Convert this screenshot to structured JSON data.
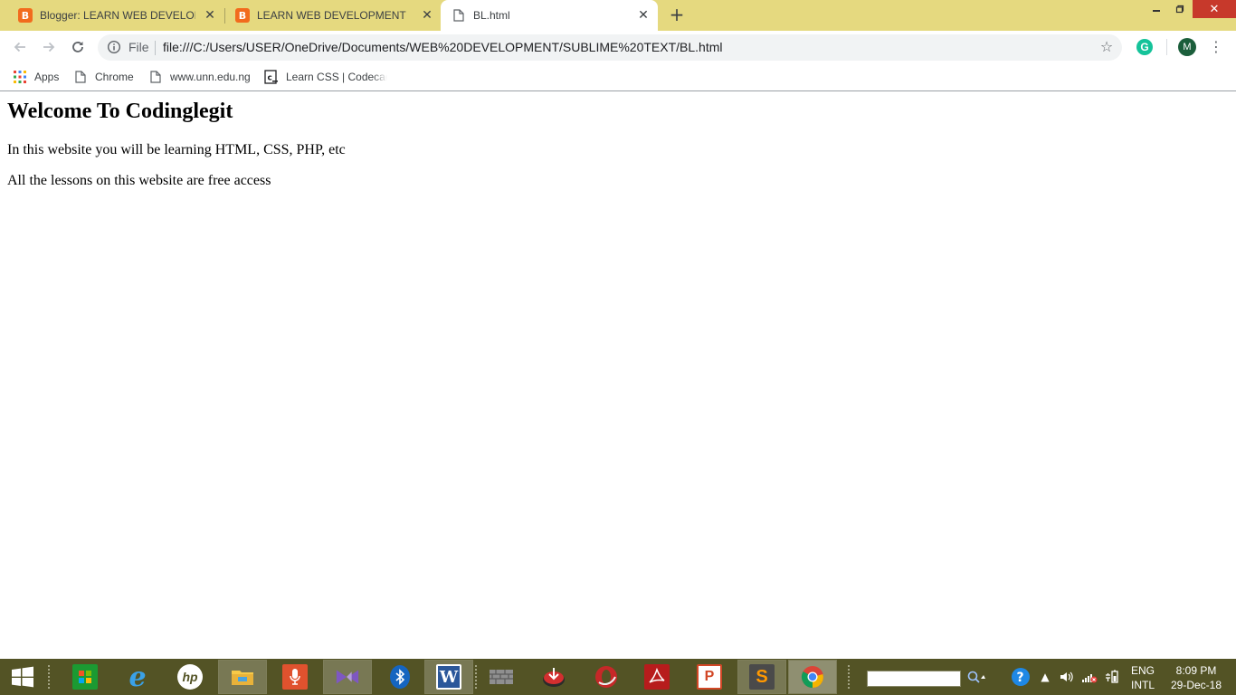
{
  "browser": {
    "tabs": [
      {
        "title": "Blogger: LEARN WEB DEVELOPM",
        "favicon": "blogger-icon",
        "active": false
      },
      {
        "title": "LEARN WEB DEVELOPMENT",
        "favicon": "blogger-icon",
        "active": false
      },
      {
        "title": "BL.html",
        "favicon": "page-icon",
        "active": true
      }
    ],
    "omnibox": {
      "scheme_label": "File",
      "url": "file:///C:/Users/USER/OneDrive/Documents/WEB%20DEVELOPMENT/SUBLIME%20TEXT/BL.html"
    },
    "profile_initial": "M",
    "extension_letter": "G",
    "bookmarks": [
      {
        "label": "Apps",
        "icon": "apps-grid-icon"
      },
      {
        "label": "Chrome",
        "icon": "page-icon"
      },
      {
        "label": "www.unn.edu.ng",
        "icon": "page-icon"
      },
      {
        "label": "Learn CSS | Codecademy",
        "icon": "codecademy-icon"
      }
    ],
    "colors": {
      "tab_strip": "#e5d97f",
      "blogger": "#f26b1d",
      "close_button": "#c7392b"
    }
  },
  "page": {
    "heading": "Welcome To Codinglegit",
    "paragraphs": [
      "In this website you will be learning HTML, CSS, PHP, etc",
      "All the lessons on this website are free access"
    ]
  },
  "taskbar": {
    "apps": [
      "windows-store-icon",
      "internet-explorer-icon",
      "hp-icon",
      "file-explorer-icon",
      "voice-recorder-icon",
      "visual-studio-icon",
      "bluetooth-icon",
      "word-icon",
      "firewall-icon",
      "media-downloader-icon",
      "opera-icon",
      "acrobat-icon",
      "powerpoint-icon",
      "sublime-text-icon",
      "chrome-icon"
    ],
    "language": {
      "line1": "ENG",
      "line2": "INTL"
    },
    "clock": {
      "time": "8:09 PM",
      "date": "29-Dec-18"
    },
    "color": "#535325"
  }
}
